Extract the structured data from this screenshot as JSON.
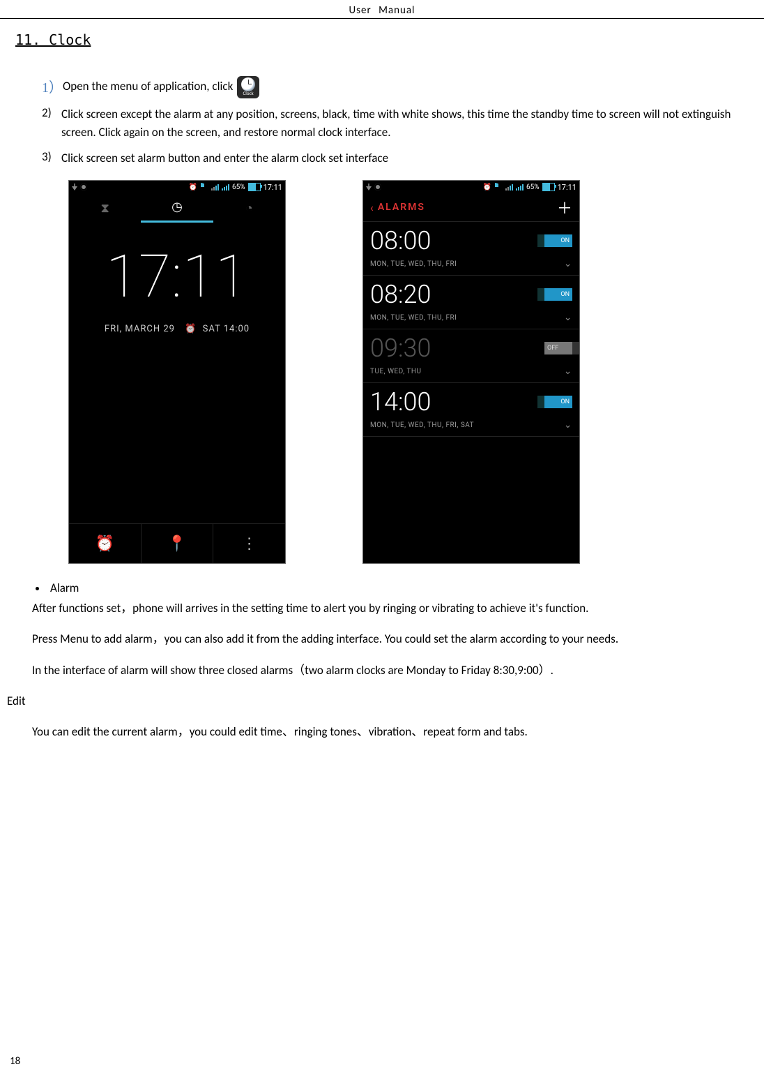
{
  "header": {
    "title": "User  Manual"
  },
  "section": {
    "heading": "11. Clock"
  },
  "steps": [
    {
      "num": "1）",
      "text_before": "Open the menu of application, click",
      "icon_label": "Clock"
    },
    {
      "num": "2)",
      "text": "Click screen except the alarm at any position, screens, black, time with white shows, this time the standby time to screen will not extinguish screen. Click again on the screen, and restore normal clock interface."
    },
    {
      "num": "3)",
      "text": "Click screen set alarm button and enter the alarm clock set interface"
    }
  ],
  "statusbar": {
    "pct": "65%",
    "time": "17:11"
  },
  "clock_screen": {
    "tabs": {
      "timer": "⧗",
      "clock": "◷",
      "stopwatch": "◔"
    },
    "time": "17:11",
    "date": "FRI, MARCH 29",
    "next_alarm": "SAT 14:00",
    "bottom": {
      "alarms": "⏰",
      "places": "📍",
      "menu": "⋮"
    }
  },
  "alarms_screen": {
    "back": "‹",
    "title": "ALARMS",
    "add": "＋",
    "items": [
      {
        "h": "08:",
        "m": "00",
        "days": "MON, TUE, WED, THU, FRI",
        "toggle": "ON",
        "on": true
      },
      {
        "h": "08:",
        "m": "20",
        "days": "MON, TUE, WED, THU, FRI",
        "toggle": "ON",
        "on": true
      },
      {
        "h": "09:",
        "m": "30",
        "days": "TUE, WED, THU",
        "toggle": "OFF",
        "on": false
      },
      {
        "h": "14:",
        "m": "00",
        "days": "MON, TUE, WED, THU, FRI, SAT",
        "toggle": "ON",
        "on": true
      }
    ],
    "chev": "⌄"
  },
  "bullet": {
    "label": "Alarm"
  },
  "paragraphs": {
    "p1": "After functions set，phone will arrives in the setting time to alert you by ringing or vibrating to achieve it's function.",
    "p2": "Press Menu to add alarm，you can also add it from the adding interface. You could set the alarm according to your needs.",
    "p3": "In the interface of alarm will show three closed alarms（two alarm clocks are Monday to Friday 8:30,9:00）.",
    "edit_label": "Edit",
    "p4": "You can edit the current alarm，you could edit time、ringing tones、vibration、repeat form and tabs."
  },
  "page_number": "18"
}
